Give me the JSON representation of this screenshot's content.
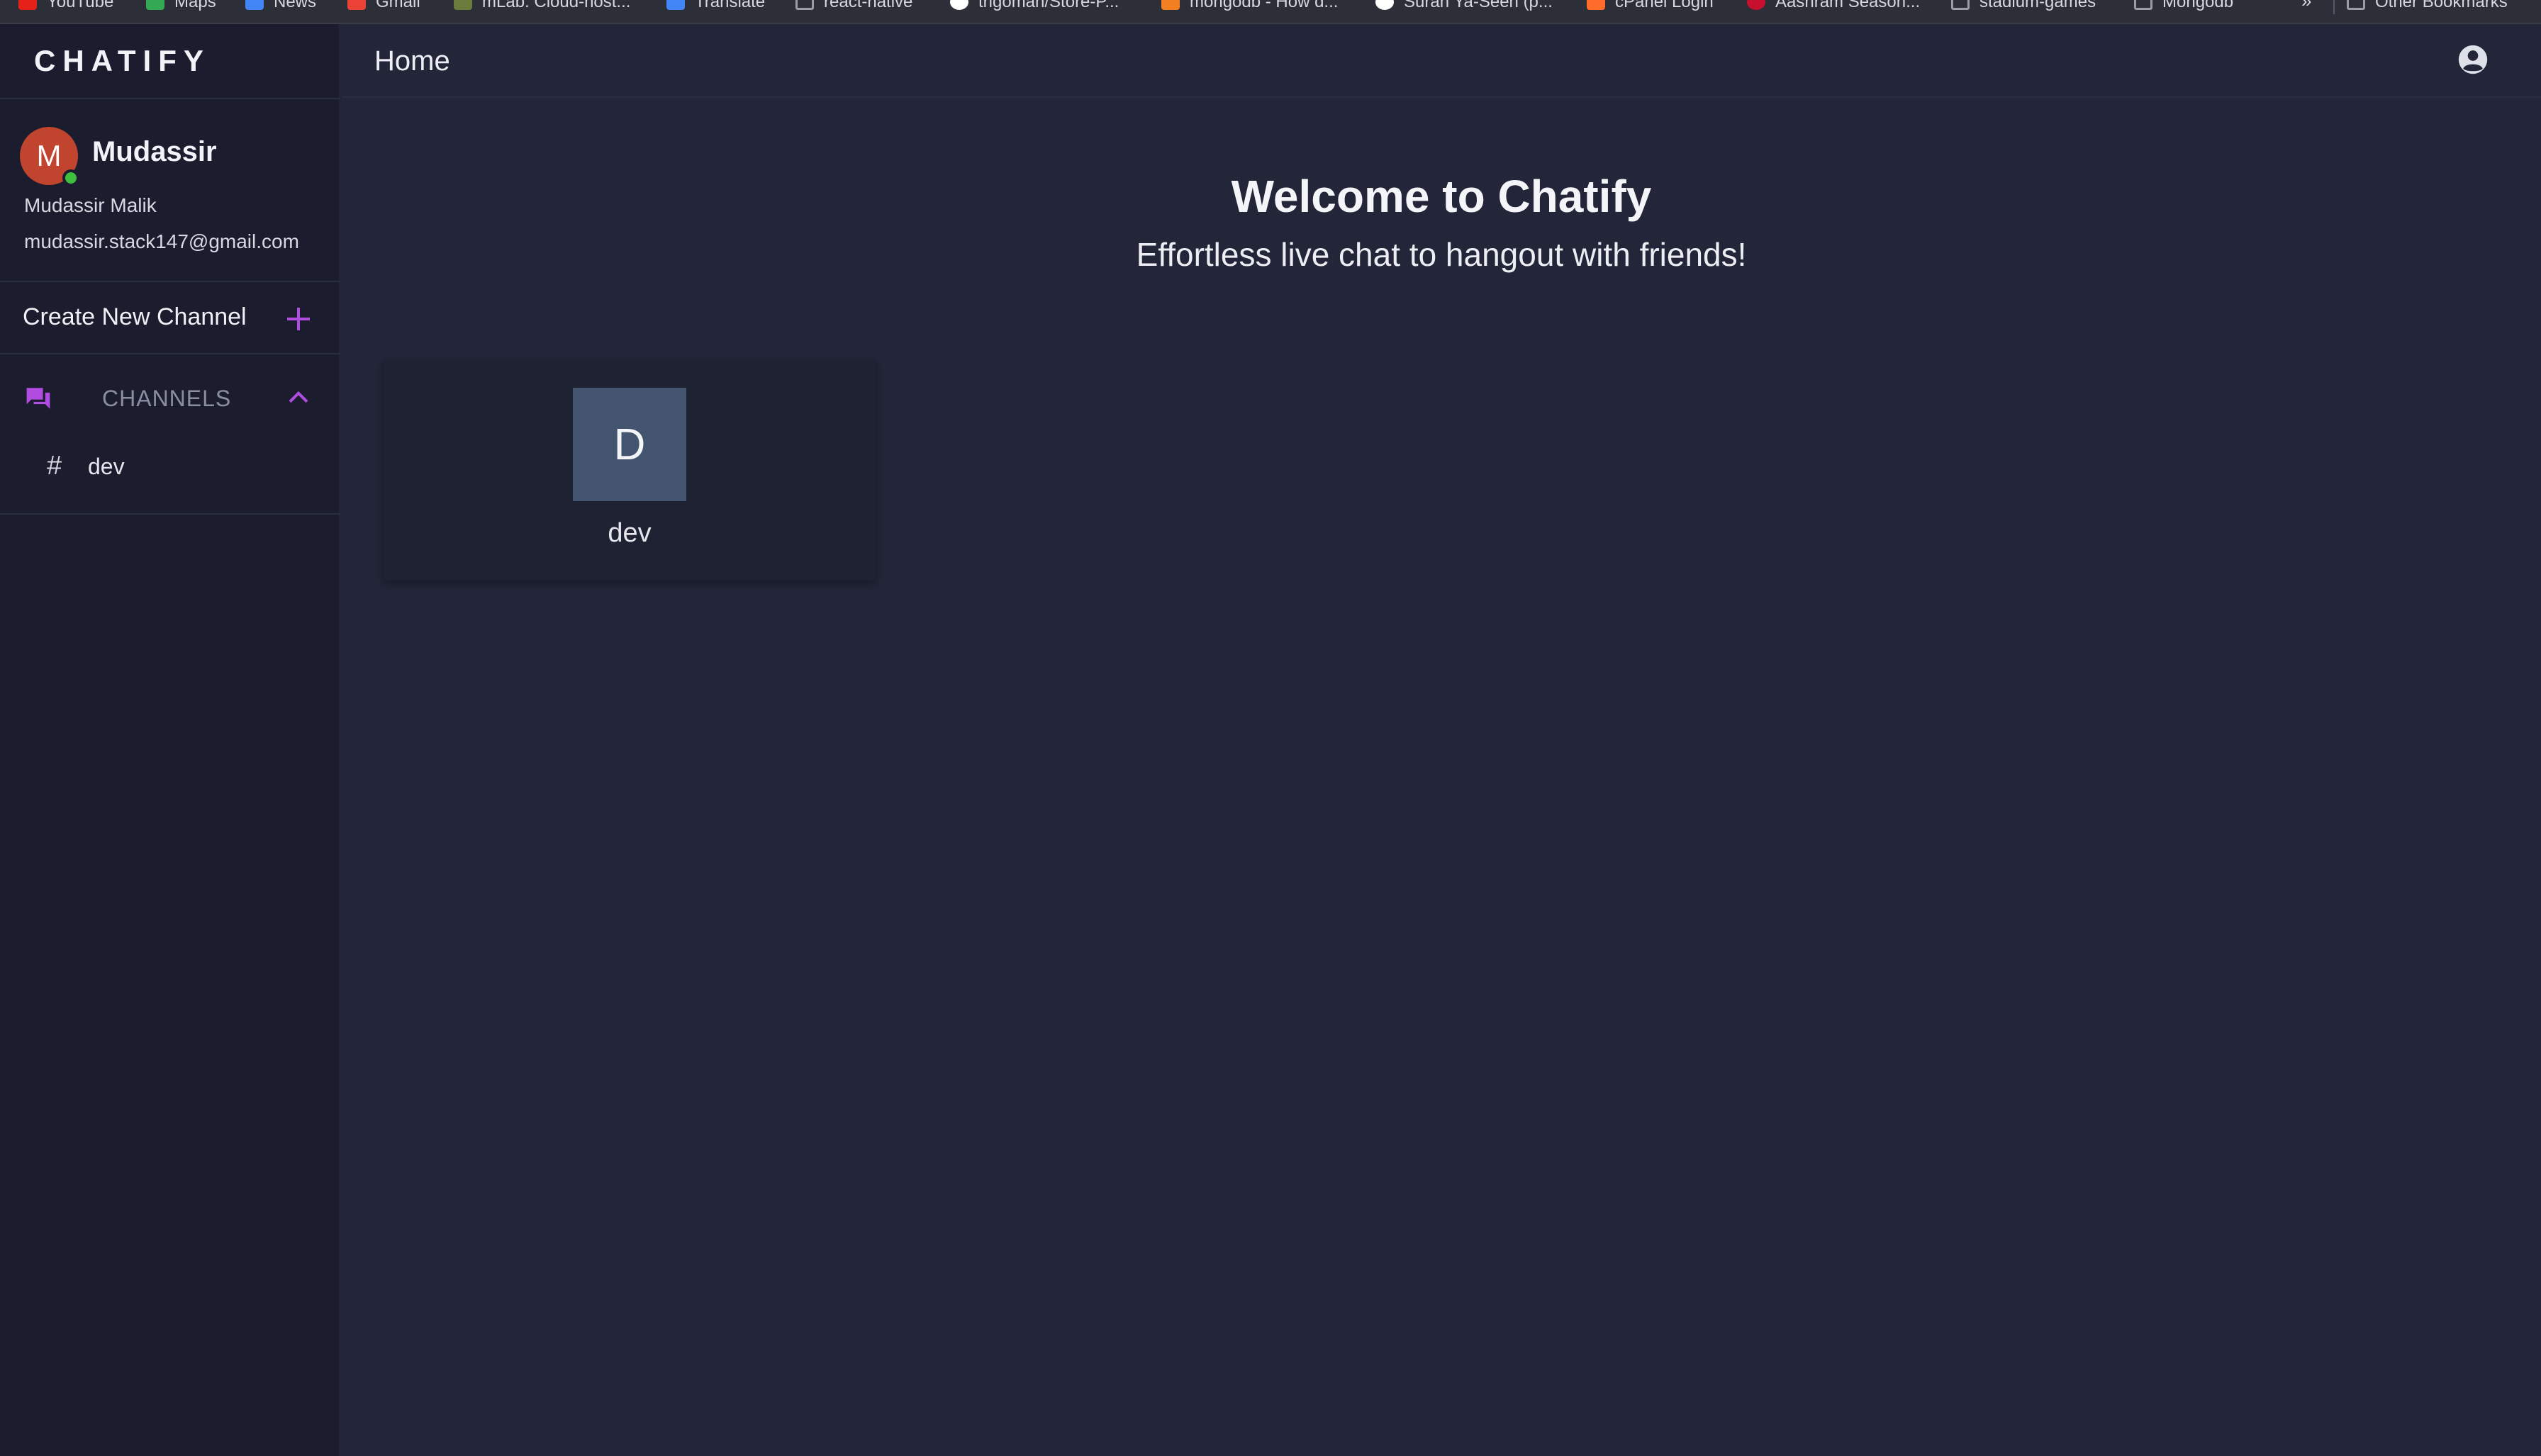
{
  "bookmarks": [
    {
      "label": "YouTube",
      "icon": "youtube-icon",
      "color": "#e62117"
    },
    {
      "label": "Maps",
      "icon": "maps-icon",
      "color": "#34a853"
    },
    {
      "label": "News",
      "icon": "news-icon",
      "color": "#4285f4"
    },
    {
      "label": "Gmail",
      "icon": "gmail-icon",
      "color": "#ea4335"
    },
    {
      "label": "mLab: Cloud-host...",
      "icon": "mlab-icon",
      "color": "#6b7b3b"
    },
    {
      "label": "Translate",
      "icon": "translate-icon",
      "color": "#4285f4"
    },
    {
      "label": "react-native",
      "icon": "folder-icon",
      "color": "#9a9ca6"
    },
    {
      "label": "trigoman/Store-P...",
      "icon": "github-icon",
      "color": "#ffffff"
    },
    {
      "label": "mongodb - How d...",
      "icon": "stackoverflow-icon",
      "color": "#f48024"
    },
    {
      "label": "Surah Ya-Seen (p...",
      "icon": "globe-icon",
      "color": "#ffffff"
    },
    {
      "label": "cPanel Login",
      "icon": "cpanel-icon",
      "color": "#ff6c2c"
    },
    {
      "label": "Aashram Season...",
      "icon": "aashram-icon",
      "color": "#c8102e"
    },
    {
      "label": "stadium-games",
      "icon": "folder-icon",
      "color": "#9a9ca6"
    },
    {
      "label": "Mongodb",
      "icon": "folder-icon",
      "color": "#9a9ca6"
    }
  ],
  "bookmarks_overflow": "»",
  "other_bookmarks": "Other Bookmarks",
  "app": {
    "brand": "CHATIFY",
    "accent_color": "#b04de0"
  },
  "user": {
    "initial": "M",
    "username": "Mudassir",
    "full_name": "Mudassir Malik",
    "email": "mudassir.stack147@gmail.com",
    "status_color": "#3fbf3f"
  },
  "sidebar": {
    "create_channel_label": "Create New Channel",
    "channels_label": "CHANNELS",
    "channels": [
      {
        "name": "dev"
      }
    ]
  },
  "topbar": {
    "title": "Home"
  },
  "main": {
    "welcome_title": "Welcome to Chatify",
    "welcome_subtitle": "Effortless live chat to hangout with friends!",
    "cards": [
      {
        "initial": "D",
        "name": "dev"
      }
    ]
  }
}
